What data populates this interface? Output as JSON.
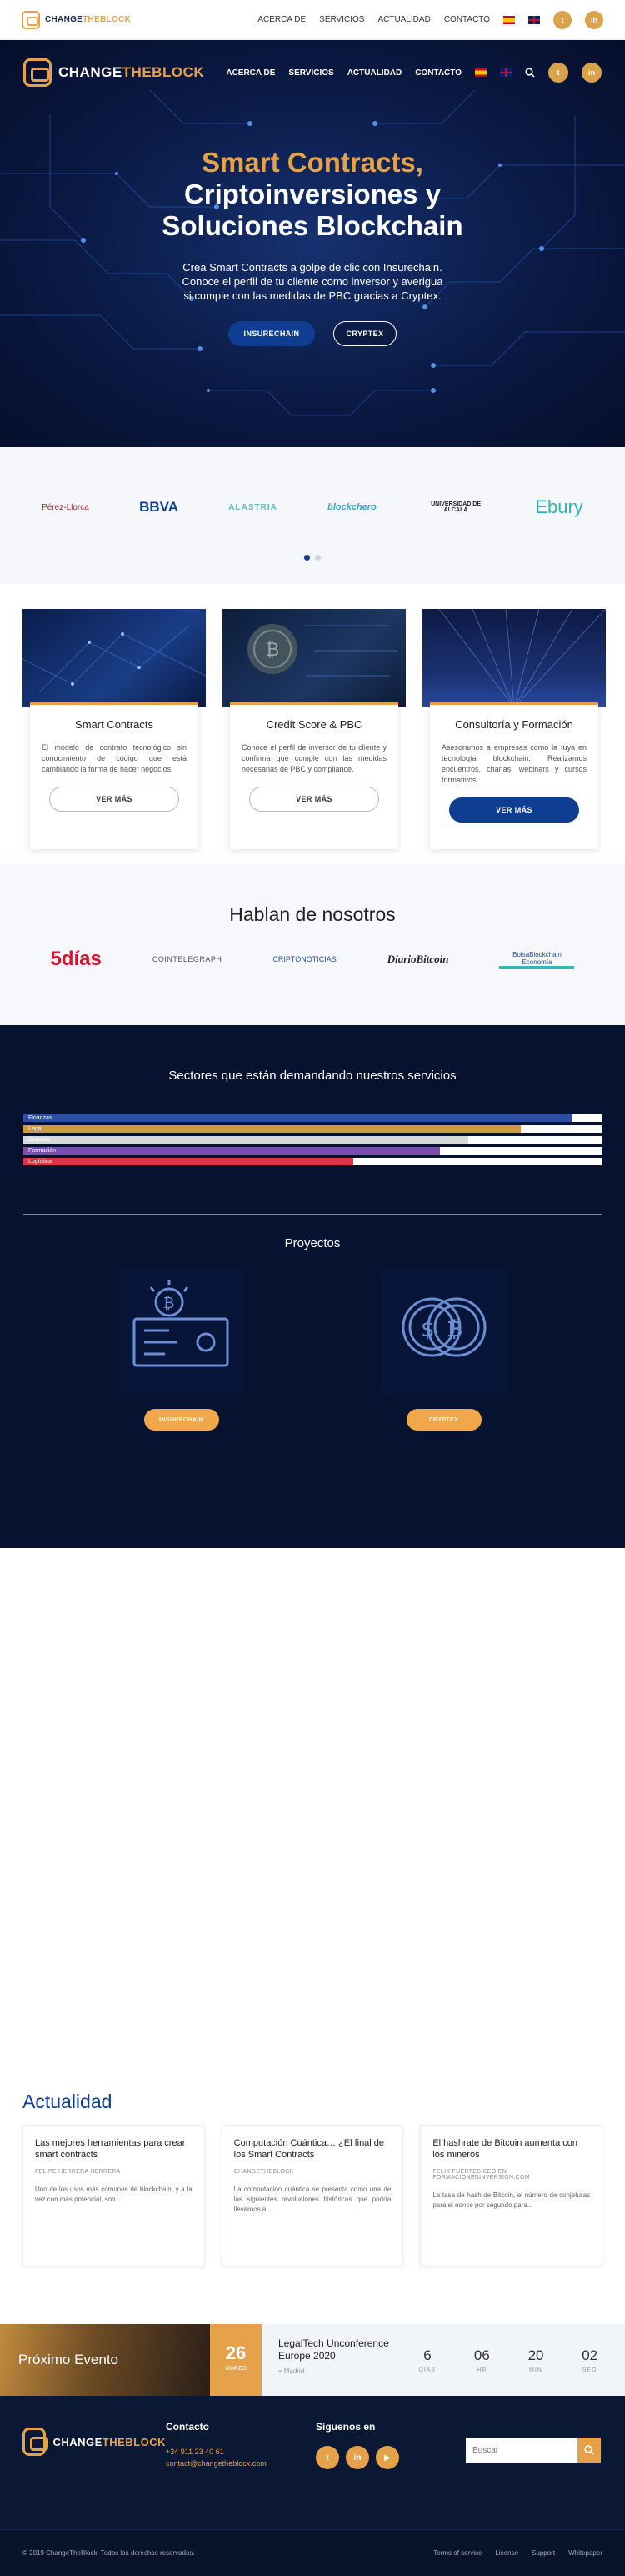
{
  "topbar": {
    "logo_main": "CHANGE",
    "logo_accent": "THEBLOCK",
    "nav": [
      "ACERCA DE",
      "SERVICIOS",
      "ACTUALIDAD",
      "CONTACTO"
    ],
    "social": [
      "twitter-icon",
      "linkedin-icon"
    ]
  },
  "hero": {
    "logo_main": "CHANGE",
    "logo_accent": "THEBLOCK",
    "nav": [
      "ACERCA DE",
      "SERVICIOS",
      "ACTUALIDAD",
      "CONTACTO"
    ],
    "title_gold": "Smart Contracts,",
    "title_line2": "Criptoinversiones y",
    "title_line3": "Soluciones Blockchain",
    "desc_line1": "Crea Smart Contracts a golpe de clic con Insurechain.",
    "desc_line2": "Conoce el perfil de tu cliente como inversor y averigua",
    "desc_line3": "si cumple con las medidas de PBC gracias a Cryptex.",
    "btn_primary": "INSURECHAIN",
    "btn_secondary": "CRYPTEX"
  },
  "partners": [
    "Pérez-Llorca",
    "BBVA",
    "ALASTRIA",
    "blockchero",
    "UNIVERSIDAD DE ALCALÁ",
    "Ebury"
  ],
  "services": [
    {
      "title": "Smart Contracts",
      "text": "El modelo de contrato tecnológico sin conocimiento de código que está cambiando la forma de hacer negocios.",
      "btn": "VER MÁS"
    },
    {
      "title": "Credit Score & PBC",
      "text": "Conoce el perfil de inversor de tu cliente y confirma que cumple con las medidas necesarias de PBC y compliance.",
      "btn": "VER MÁS"
    },
    {
      "title": "Consultoría y Formación",
      "text": "Asesoramos a empresas como la tuya en tecnología blockchain. Realizamos encuentros, charlas, webinars y cursos formativos.",
      "btn": "VER MÁS"
    }
  ],
  "press": {
    "title": "Hablan de nosotros",
    "logos": [
      "5días",
      "COINTELEGRAPH",
      "CRIPTONOTICIAS",
      "DiarioBitcoin",
      "BolsaBlockchain Economía"
    ]
  },
  "sectors": {
    "title": "Sectores que están demandando nuestros servicios",
    "items": [
      {
        "label": "Finanzas",
        "value": 95,
        "color": "#2d4fa3"
      },
      {
        "label": "Legal",
        "value": 86,
        "color": "#d19a3a"
      },
      {
        "label": "Seguros",
        "value": 77,
        "color": "#d8d8d8"
      },
      {
        "label": "Formación",
        "value": 72,
        "color": "#7a4bb0"
      },
      {
        "label": "Logística",
        "value": 57,
        "color": "#d8344b"
      }
    ]
  },
  "projects": {
    "title": "Proyectos",
    "items": [
      {
        "name": "INSURECHAIN"
      },
      {
        "name": "CRYPTEX"
      }
    ]
  },
  "news": {
    "title": "Actualidad",
    "items": [
      {
        "title": "Las mejores herramientas para crear smart contracts",
        "author": "FELIPE HERRERA HERRERA",
        "excerpt": "Uno de los usos más comunes de blockchain, y a la vez con más potencial, son..."
      },
      {
        "title": "Computación Cuántica… ¿El final de los Smart Contracts",
        "author": "CHANGETHEBLOCK",
        "excerpt": "La computación cuántica se presenta como una de las siguientes revoluciones históricas que podría llevarnos a..."
      },
      {
        "title": "El hashrate de Bitcoin aumenta con los mineros",
        "author": "FELIX FUERTES.CEO EN FORMACIONENINVERSION.COM",
        "excerpt": "La tasa de hash de Bitcoin, el número de conjeturas para el nonce por segundo para..."
      }
    ]
  },
  "event": {
    "label": "Próximo Evento",
    "day": "26",
    "month": "MARZO",
    "title": "LegalTech Unconference Europe 2020",
    "location": "Madrid",
    "countdown": [
      {
        "n": "6",
        "l": "DÍAS"
      },
      {
        "n": "06",
        "l": "HR"
      },
      {
        "n": "20",
        "l": "MIN"
      },
      {
        "n": "02",
        "l": "SEG"
      }
    ]
  },
  "footer": {
    "logo_main": "CHANGE",
    "logo_accent": "THEBLOCK",
    "contact_title": "Contacto",
    "phone": "+34 911 23 40 61",
    "email": "contact@changetheblock.com",
    "social_title": "Síguenos en",
    "search_placeholder": "Buscar",
    "copyright": "© 2019 ChangeTheBlock. Todos los derechos reservados.",
    "links": [
      "Terms of service",
      "License",
      "Support",
      "Whitepaper"
    ]
  }
}
